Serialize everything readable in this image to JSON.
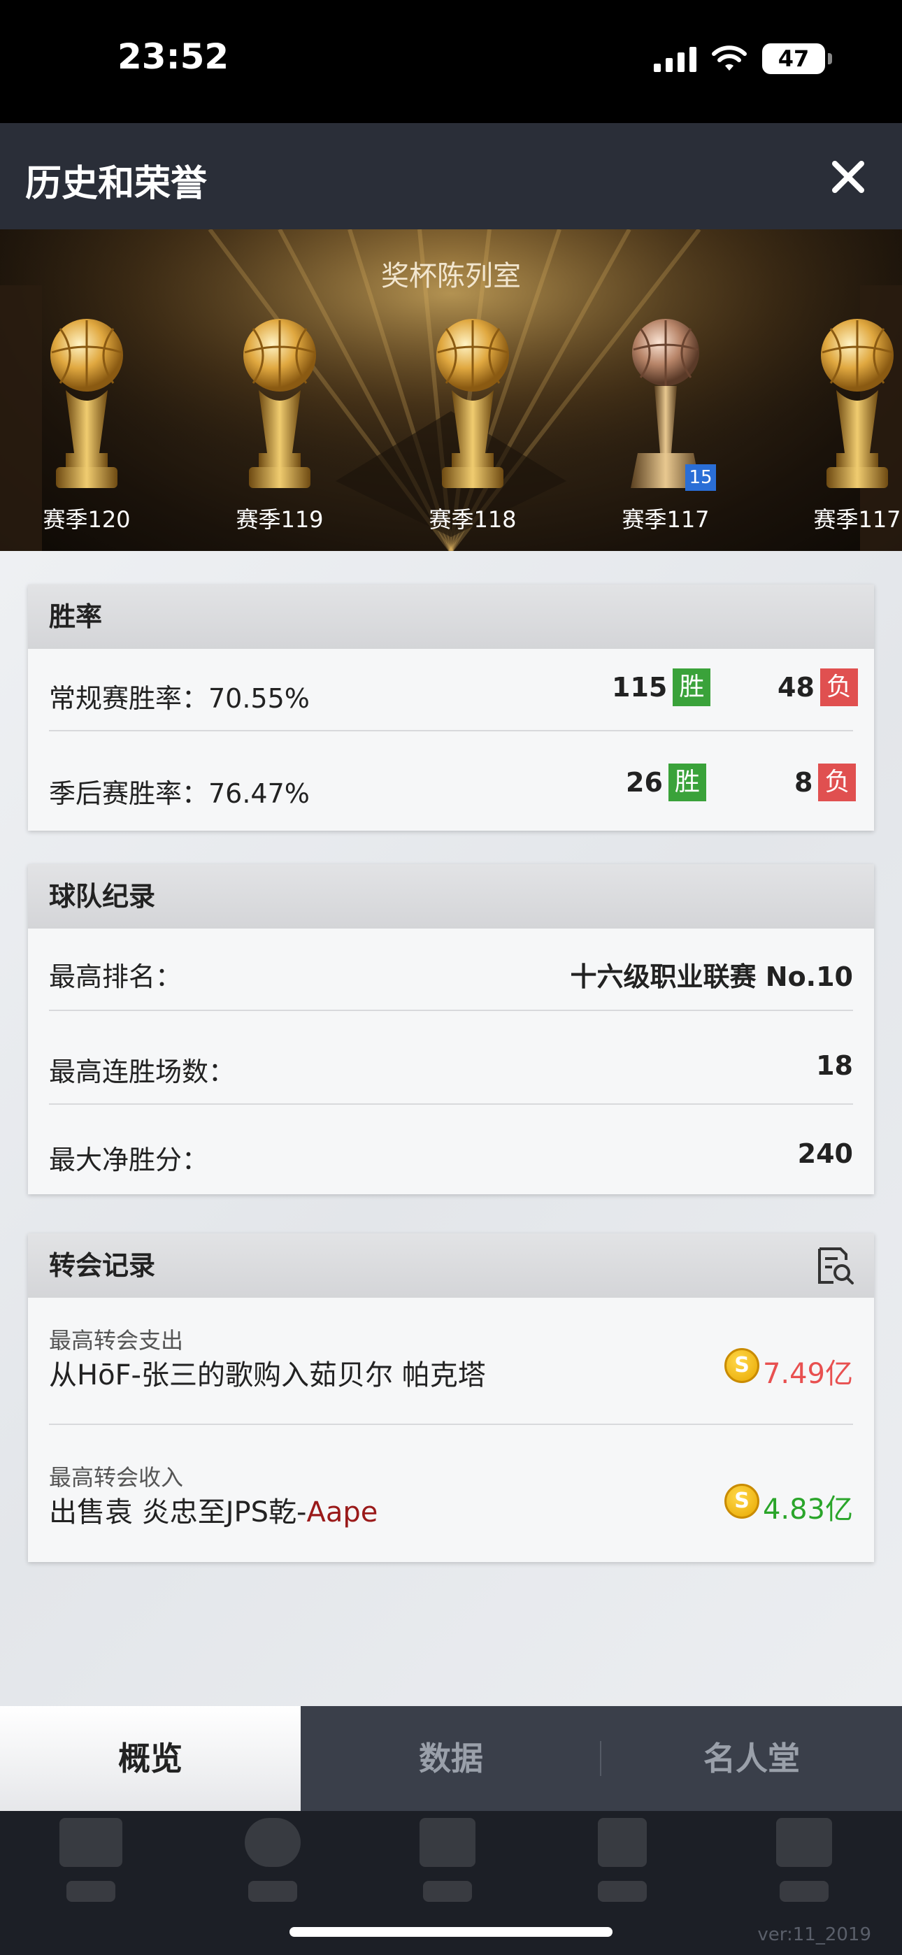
{
  "status_bar": {
    "time": "23:52",
    "battery": "47"
  },
  "header": {
    "title": "历史和荣誉"
  },
  "banner": {
    "title": "奖杯陈列室",
    "trophies": [
      {
        "label": "赛季120",
        "style": "gold"
      },
      {
        "label": "赛季119",
        "style": "gold"
      },
      {
        "label": "赛季118",
        "style": "gold"
      },
      {
        "label": "赛季117",
        "style": "bronze",
        "badge": "15"
      },
      {
        "label": "赛季117",
        "style": "gold"
      }
    ]
  },
  "win_rate": {
    "title": "胜率",
    "regular": {
      "label": "常规赛胜率：70.55%",
      "wins": "115",
      "losses": "48"
    },
    "playoff": {
      "label": "季后赛胜率：76.47%",
      "wins": "26",
      "losses": "8"
    },
    "win_tag": "胜",
    "loss_tag": "负"
  },
  "team_record": {
    "title": "球队纪录",
    "rows": [
      {
        "label": "最高排名：",
        "value": "十六级职业联赛 No.10"
      },
      {
        "label": "最高连胜场数：",
        "value": "18"
      },
      {
        "label": "最大净胜分：",
        "value": "240"
      }
    ]
  },
  "transfer_record": {
    "title": "转会记录",
    "spend": {
      "label": "最高转会支出",
      "text": "从HōF-张三的歌购入茹贝尔 帕克塔",
      "amount": "7.49亿",
      "color": "#e85050"
    },
    "income": {
      "label": "最高转会收入",
      "text_prefix": "出售袁 炎忠至JPS乾-",
      "text_highlight": "Aape",
      "amount": "4.83亿",
      "color": "#2aa52a"
    },
    "coin_symbol": "S"
  },
  "tabs": [
    {
      "label": "概览",
      "active": true
    },
    {
      "label": "数据",
      "active": false
    },
    {
      "label": "名人堂",
      "active": false
    }
  ],
  "version": "ver:11_2019"
}
